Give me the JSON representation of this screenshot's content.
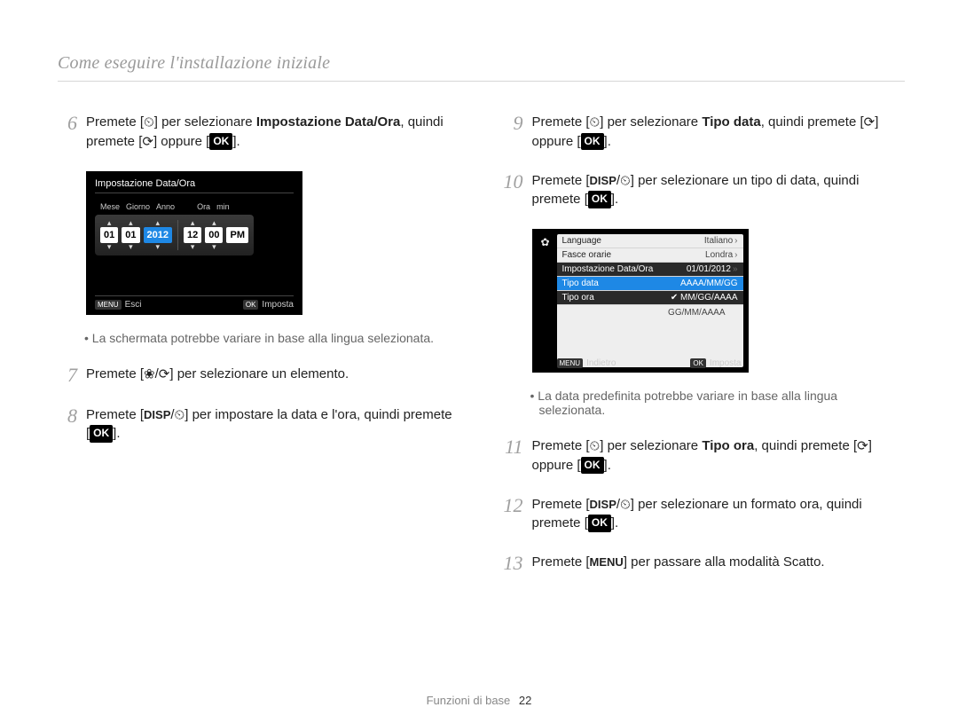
{
  "header": "Come eseguire l'installazione iniziale",
  "footer_label": "Funzioni di base",
  "footer_page": "22",
  "icons": {
    "timer_right": "⏲",
    "timer_down": "⟳",
    "ok": "OK",
    "disp": "DISP",
    "menu": "MENU",
    "macro": "❀"
  },
  "screen1": {
    "title": "Impostazione Data/Ora",
    "labels": {
      "mese": "Mese",
      "giorno": "Giorno",
      "anno": "Anno",
      "ora": "Ora",
      "min": "min"
    },
    "values": {
      "mese": "01",
      "giorno": "01",
      "anno": "2012",
      "ora": "12",
      "min": "00",
      "ampm": "PM"
    },
    "footer_left": "Esci",
    "footer_right": "Imposta",
    "footer_left_tag": "MENU",
    "footer_right_tag": "OK"
  },
  "screen2": {
    "rows": [
      {
        "l": "Language",
        "r": "Italiano",
        "chev": true
      },
      {
        "l": "Fasce orarie",
        "r": "Londra",
        "chev": true
      },
      {
        "l": "Impostazione Data/Ora",
        "r": "01/01/2012",
        "dchev": true,
        "bar": true
      },
      {
        "l": "Tipo data",
        "r": "AAAA/MM/GG",
        "hl": true
      },
      {
        "l": "Tipo ora",
        "r": "MM/GG/AAAA",
        "check": true,
        "bar": true
      },
      {
        "l": "",
        "r": "GG/MM/AAAA",
        "rightonly": true
      }
    ],
    "footer_left": "Indietro",
    "footer_right": "Imposta",
    "footer_left_tag": "MENU",
    "footer_right_tag": "OK"
  },
  "left_steps": {
    "s6_a": "Premete [",
    "s6_b": "] per selezionare ",
    "s6_bold": "Impostazione Data/Ora",
    "s6_c": ", quindi premete [",
    "s6_d": "] oppure [",
    "s6_e": "].",
    "note1": "La schermata potrebbe variare in base alla lingua selezionata.",
    "s7_a": "Premete [",
    "s7_b": "] per selezionare un elemento.",
    "s8_a": "Premete [",
    "s8_b": "] per impostare la data e l'ora, quindi premete [",
    "s8_c": "]."
  },
  "right_steps": {
    "s9_a": "Premete [",
    "s9_b": "] per selezionare ",
    "s9_bold": "Tipo data",
    "s9_c": ", quindi premete [",
    "s9_d": "] oppure [",
    "s9_e": "].",
    "s10_a": "Premete [",
    "s10_b": "] per selezionare un tipo di data, quindi premete [",
    "s10_c": "].",
    "note2": "La data predefinita potrebbe variare in base alla lingua selezionata.",
    "s11_a": "Premete [",
    "s11_b": "] per selezionare ",
    "s11_bold": "Tipo ora",
    "s11_c": ", quindi premete [",
    "s11_d": "] oppure [",
    "s11_e": "].",
    "s12_a": "Premete [",
    "s12_b": "] per selezionare un formato ora, quindi premete [",
    "s12_c": "].",
    "s13_a": "Premete [",
    "s13_b": "] per passare alla modalità Scatto."
  },
  "nums": {
    "n6": "6",
    "n7": "7",
    "n8": "8",
    "n9": "9",
    "n10": "10",
    "n11": "11",
    "n12": "12",
    "n13": "13"
  }
}
